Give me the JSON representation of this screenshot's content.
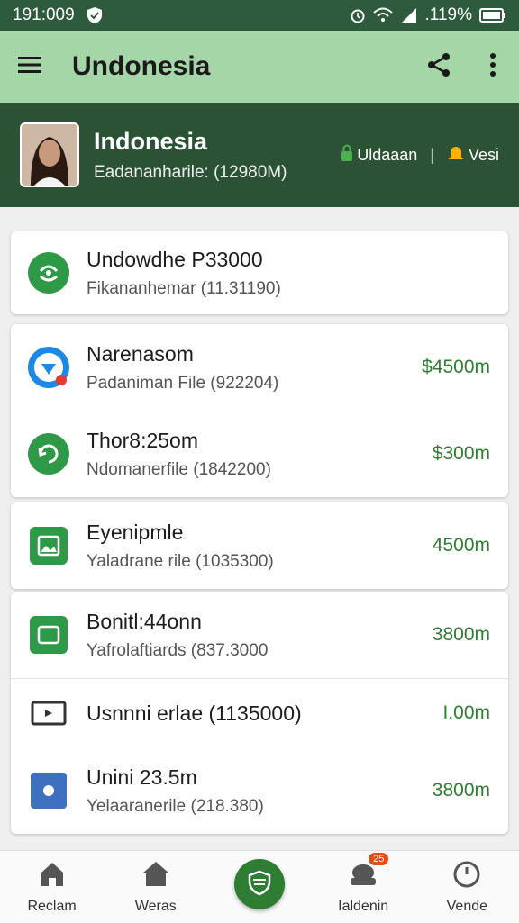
{
  "status_bar": {
    "time": "191:009",
    "battery": ".119%"
  },
  "app_bar": {
    "title": "Undonesia"
  },
  "header": {
    "name": "Indonesia",
    "subtitle": "Eadananharile: (12980M)",
    "badge_left": "Uldaaan",
    "badge_right": "Vesi"
  },
  "items": [
    {
      "title": "Undowdhe P33000",
      "subtitle": "Fikananhemar (11.31190)",
      "amount": ""
    },
    {
      "title": "Narenasom",
      "subtitle": "Padaniman File (922204)",
      "amount": "$4500m"
    },
    {
      "title": "Thor8:25om",
      "subtitle": "Ndomanerfile (1842200)",
      "amount": "$300m"
    },
    {
      "title": "Eyenipmle",
      "subtitle": "Yaladrane rile (1035300)",
      "amount": "4500m"
    },
    {
      "title": "Bonitl:44onn",
      "subtitle": "Yafrolaftiards (837.3000",
      "amount": "3800m"
    },
    {
      "title": "Usnnni erlae (1135000)",
      "subtitle": "",
      "amount": "I.00m"
    },
    {
      "title": "Unini 23.5m",
      "subtitle": "Yelaaranerile (218.380)",
      "amount": "3800m"
    }
  ],
  "bottom_nav": {
    "items": [
      {
        "label": "Reclam"
      },
      {
        "label": "Weras"
      },
      {
        "label": ""
      },
      {
        "label": "Ialdenin",
        "badge": "25"
      },
      {
        "label": "Vende"
      }
    ]
  },
  "colors": {
    "primary": "#2e7d32",
    "app_bar": "#a5d6a7",
    "header": "#2b5234"
  }
}
